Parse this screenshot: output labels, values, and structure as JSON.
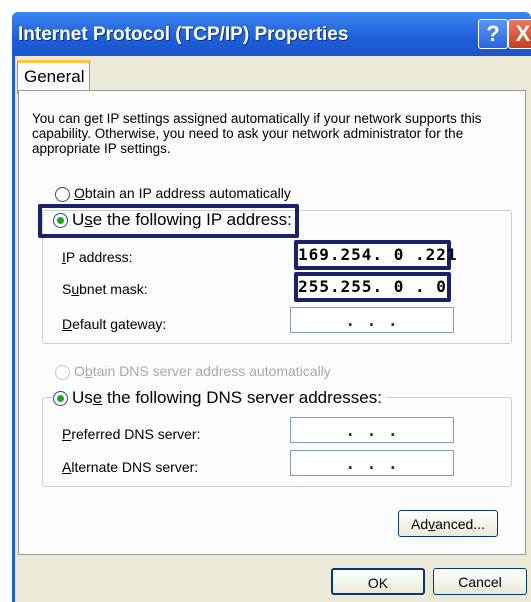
{
  "window": {
    "title": "Internet Protocol (TCP/IP) Properties",
    "help_label": "?",
    "close_label": "X"
  },
  "tabs": [
    {
      "label": "General"
    }
  ],
  "general": {
    "description": "You can get IP settings assigned automatically if your network supports this capability. Otherwise, you need to ask your network administrator for the appropriate IP settings.",
    "ip_auto": {
      "first": "O",
      "rest": "btain an IP address automatically",
      "selected": false
    },
    "ip_manual": {
      "pre": "U",
      "u": "s",
      "rest": "e the following IP address:",
      "selected": true
    },
    "ip_address": {
      "u": "I",
      "rest": "P address:",
      "value": "169.254. 0 .221"
    },
    "subnet_mask": {
      "pre": "S",
      "u": "u",
      "rest": "bnet mask:",
      "value": "255.255. 0 . 0"
    },
    "default_gateway": {
      "u": "D",
      "rest": "efault gateway:",
      "value": ". . ."
    },
    "dns_auto": {
      "pre": "O",
      "u": "b",
      "rest": "tain DNS server address automatically",
      "selected": false,
      "disabled": true
    },
    "dns_manual": {
      "pre": "Us",
      "u": "e",
      "rest": " the following DNS server addresses:",
      "selected": true
    },
    "preferred_dns": {
      "u": "P",
      "rest": "referred DNS server:",
      "value": ". . ."
    },
    "alternate_dns": {
      "u": "A",
      "rest": "lternate DNS server:",
      "value": ". . ."
    },
    "advanced_button": {
      "pre": "Ad",
      "u": "v",
      "rest": "anced..."
    }
  },
  "footer": {
    "ok_label": "OK",
    "cancel_label": "Cancel"
  }
}
